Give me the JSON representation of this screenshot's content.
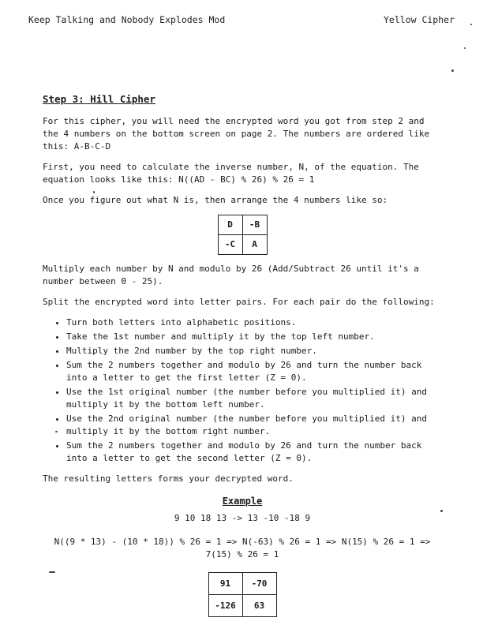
{
  "header": {
    "left": "Keep Talking and Nobody Explodes Mod",
    "right": "Yellow Cipher"
  },
  "section": {
    "title": "Step 3: Hill Cipher",
    "p1": "For this cipher, you will need the encrypted word you got from step 2 and the 4 numbers on the bottom screen on page 2. The numbers are ordered like this: A-B-C-D",
    "p2": "First, you need to calculate the inverse number, N, of the equation. The equation looks like this: N((AD - BC) % 26) % 26 = 1",
    "p3": "Once you figure out what N is, then arrange the 4 numbers like so:",
    "matrix": [
      [
        "D",
        "-B"
      ],
      [
        "-C",
        "A"
      ]
    ],
    "p4": "Multiply each number by N and modulo by 26 (Add/Subtract 26 until it's a number between 0 - 25).",
    "p5": "Split the encrypted word into letter pairs. For each pair do the following:",
    "steps": [
      "Turn both letters into alphabetic positions.",
      "Take the 1st number and multiply it by the top left number.",
      "Multiply the 2nd number by the top right number.",
      "Sum the 2 numbers together and modulo by 26 and turn the number back into a letter to get the first letter (Z = 0).",
      "Use the 1st original number (the number before you multiplied it) and multiply it by the bottom left number.",
      "Use the 2nd original number (the number before you multiplied it) and multiply it by the bottom right number.",
      "Sum the 2 numbers together and modulo by 26 and turn the number back into a letter to get the second letter (Z = 0)."
    ],
    "p6": "The resulting letters forms your decrypted word."
  },
  "example": {
    "title": "Example",
    "line1": "9 10 18 13 -> 13 -10 -18 9",
    "line2": "N((9 * 13) - (10 * 18)) % 26 = 1 => N(-63) % 26 = 1 => N(15) % 26 = 1 => 7(15) % 26 = 1",
    "matrix": [
      [
        "91",
        "-70"
      ],
      [
        "-126",
        "63"
      ]
    ]
  }
}
